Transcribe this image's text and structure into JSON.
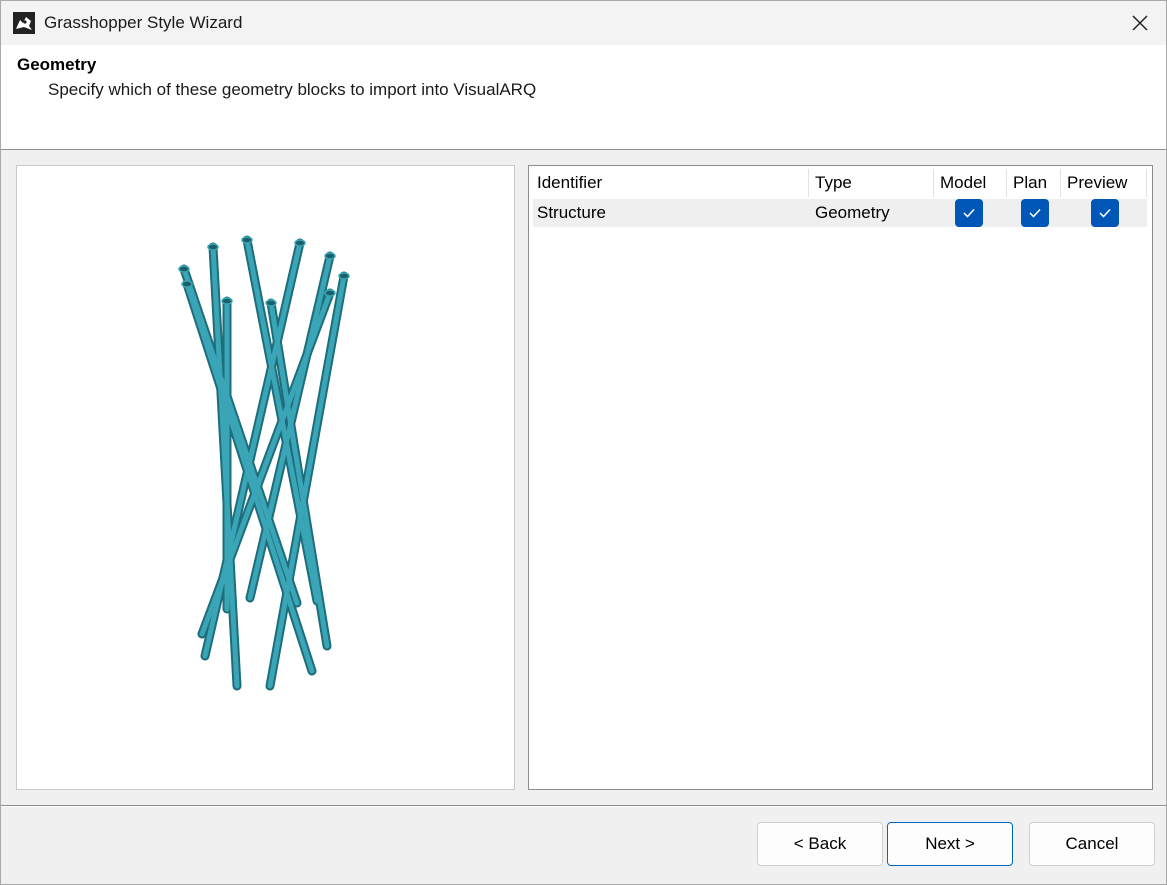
{
  "window": {
    "title": "Grasshopper Style Wizard"
  },
  "header": {
    "title": "Geometry",
    "subtitle": "Specify which of these geometry blocks to import into VisualARQ"
  },
  "grid": {
    "columns": [
      "Identifier",
      "Type",
      "Model",
      "Plan",
      "Preview"
    ],
    "rows": [
      {
        "identifier": "Structure",
        "type": "Geometry",
        "model": true,
        "plan": true,
        "preview": true
      }
    ]
  },
  "buttons": {
    "back": "< Back",
    "next": "Next >",
    "cancel": "Cancel"
  },
  "colors": {
    "accent": "#0057b8",
    "geometry": "#2a8fa0"
  }
}
